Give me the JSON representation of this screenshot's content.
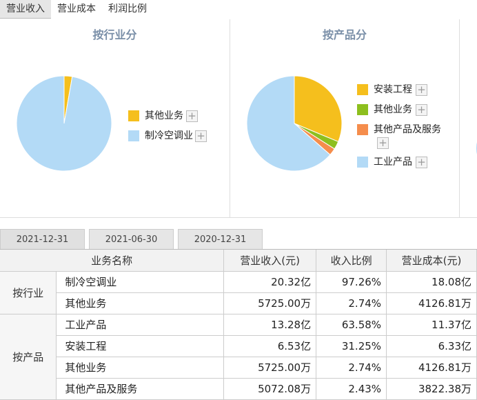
{
  "tabs": [
    {
      "label": "营业收入",
      "active": true
    },
    {
      "label": "营业成本",
      "active": false
    },
    {
      "label": "利润比例",
      "active": false
    }
  ],
  "colors": {
    "yellow": "#f5bf1d",
    "green": "#8dbf1e",
    "orange": "#f58d4c",
    "lightblue": "#b3daf6"
  },
  "panels": [
    {
      "title": "按行业分",
      "chart_data": {
        "type": "pie",
        "categories": [
          "其他业务",
          "制冷空调业"
        ],
        "values": [
          2.74,
          97.26
        ],
        "colors": [
          "#f5bf1d",
          "#b3daf6"
        ]
      },
      "legend": [
        {
          "label": "其他业务",
          "color": "#f5bf1d",
          "plus": "+"
        },
        {
          "label": "制冷空调业",
          "color": "#b3daf6",
          "plus": "+"
        }
      ]
    },
    {
      "title": "按产品分",
      "chart_data": {
        "type": "pie",
        "categories": [
          "安装工程",
          "其他业务",
          "其他产品及服务",
          "工业产品"
        ],
        "values": [
          31.25,
          2.74,
          2.43,
          63.58
        ],
        "colors": [
          "#f5bf1d",
          "#8dbf1e",
          "#f58d4c",
          "#b3daf6"
        ]
      },
      "legend": [
        {
          "label": "安装工程",
          "color": "#f5bf1d",
          "plus": "+"
        },
        {
          "label": "其他业务",
          "color": "#8dbf1e",
          "plus": "+"
        },
        {
          "label": "其他产品及服务",
          "color": "#f58d4c",
          "plus": "+"
        },
        {
          "label": "工业产品",
          "color": "#b3daf6",
          "plus": "+"
        }
      ]
    }
  ],
  "date_tabs": [
    {
      "label": "2021-12-31",
      "active": true
    },
    {
      "label": "2021-06-30",
      "active": false
    },
    {
      "label": "2020-12-31",
      "active": false
    }
  ],
  "table": {
    "headers": [
      "业务名称",
      "营业收入(元)",
      "收入比例",
      "营业成本(元)"
    ],
    "groups": [
      {
        "label": "按行业",
        "rows": [
          {
            "name": "制冷空调业",
            "revenue": "20.32亿",
            "ratio": "97.26%",
            "cost": "18.08亿"
          },
          {
            "name": "其他业务",
            "revenue": "5725.00万",
            "ratio": "2.74%",
            "cost": "4126.81万"
          }
        ]
      },
      {
        "label": "按产品",
        "rows": [
          {
            "name": "工业产品",
            "revenue": "13.28亿",
            "ratio": "63.58%",
            "cost": "11.37亿"
          },
          {
            "name": "安装工程",
            "revenue": "6.53亿",
            "ratio": "31.25%",
            "cost": "6.33亿"
          },
          {
            "name": "其他业务",
            "revenue": "5725.00万",
            "ratio": "2.74%",
            "cost": "4126.81万"
          },
          {
            "name": "其他产品及服务",
            "revenue": "5072.08万",
            "ratio": "2.43%",
            "cost": "3822.38万"
          }
        ]
      }
    ]
  }
}
